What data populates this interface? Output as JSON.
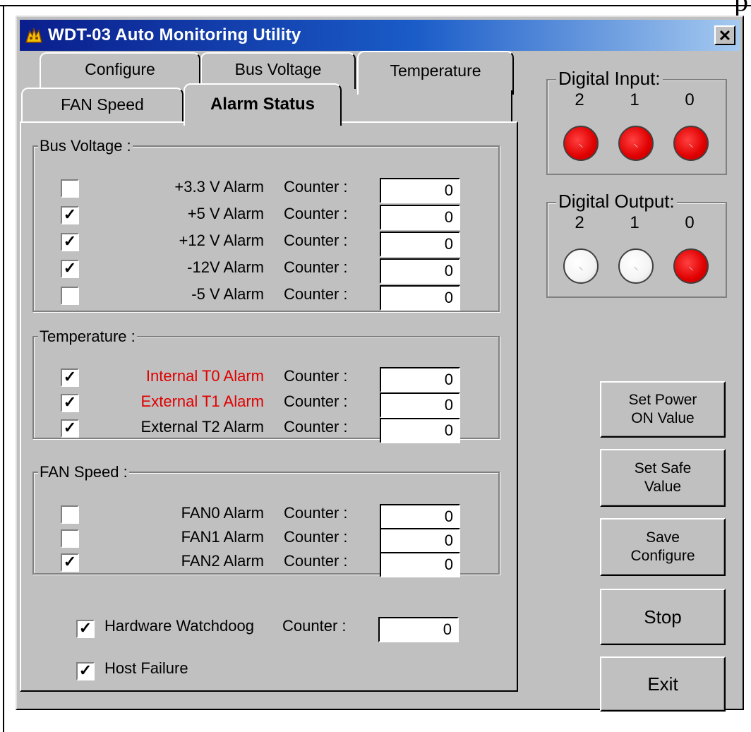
{
  "window": {
    "title": "WDT-03 Auto Monitoring Utility",
    "close_glyph": "✕"
  },
  "page_glyph": "p",
  "tabs": [
    {
      "label": "Configure"
    },
    {
      "label": "Bus Voltage"
    },
    {
      "label": "Temperature"
    },
    {
      "label": "FAN Speed"
    },
    {
      "label": "Alarm Status",
      "active": true
    }
  ],
  "bus_voltage": {
    "legend": "Bus Voltage :",
    "rows": [
      {
        "checked": false,
        "label": "+3.3 V Alarm",
        "counter_label": "Counter :",
        "counter": "0"
      },
      {
        "checked": true,
        "label": "+5 V Alarm",
        "counter_label": "Counter :",
        "counter": "0"
      },
      {
        "checked": true,
        "label": "+12 V Alarm",
        "counter_label": "Counter :",
        "counter": "0"
      },
      {
        "checked": true,
        "label": "-12V Alarm",
        "counter_label": "Counter :",
        "counter": "0"
      },
      {
        "checked": false,
        "label": "-5 V Alarm",
        "counter_label": "Counter :",
        "counter": "0"
      }
    ]
  },
  "temperature": {
    "legend": "Temperature :",
    "rows": [
      {
        "checked": true,
        "label": "Internal T0 Alarm",
        "alert": true,
        "counter_label": "Counter :",
        "counter": "0"
      },
      {
        "checked": true,
        "label": "External T1 Alarm",
        "alert": true,
        "counter_label": "Counter :",
        "counter": "0"
      },
      {
        "checked": true,
        "label": "External T2 Alarm",
        "alert": false,
        "counter_label": "Counter :",
        "counter": "0"
      }
    ]
  },
  "fan_speed": {
    "legend": "FAN Speed :",
    "rows": [
      {
        "checked": false,
        "label": "FAN0 Alarm",
        "counter_label": "Counter :",
        "counter": "0"
      },
      {
        "checked": false,
        "label": "FAN1 Alarm",
        "counter_label": "Counter :",
        "counter": "0"
      },
      {
        "checked": true,
        "label": "FAN2 Alarm",
        "counter_label": "Counter :",
        "counter": "0"
      }
    ]
  },
  "watchdog": {
    "checked": true,
    "label": "Hardware Watchdoog",
    "counter_label": "Counter :",
    "counter": "0"
  },
  "host_failure": {
    "checked": true,
    "label": "Host Failure"
  },
  "digital_input": {
    "legend": "Digital Input:",
    "channels": [
      {
        "num": "2",
        "state": "on"
      },
      {
        "num": "1",
        "state": "on"
      },
      {
        "num": "0",
        "state": "on"
      }
    ]
  },
  "digital_output": {
    "legend": "Digital Output:",
    "channels": [
      {
        "num": "2",
        "state": "off"
      },
      {
        "num": "1",
        "state": "off"
      },
      {
        "num": "0",
        "state": "on"
      }
    ]
  },
  "buttons": {
    "set_power_on": "Set Power\nON Value",
    "set_safe": "Set Safe\nValue",
    "save_configure": "Save\nConfigure",
    "stop": "Stop",
    "exit": "Exit"
  },
  "colors": {
    "title_bar": "#0a1e8c",
    "alert_text": "#e00000",
    "led_on": "#e00000",
    "led_off": "#ffffff",
    "window_face": "#c0c0c0"
  },
  "check_glyph": "✓"
}
